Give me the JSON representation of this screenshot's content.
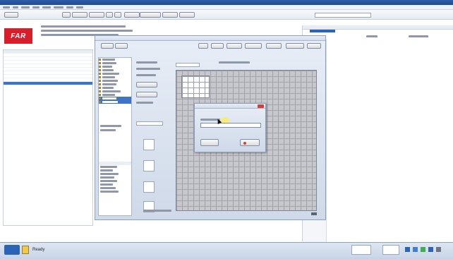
{
  "app": {
    "logo_text": "FAR",
    "title": "",
    "accent_color": "#2b63b6",
    "logo_color": "#d81e2a"
  },
  "dialog": {
    "title": ""
  },
  "modal": {
    "title": "",
    "label": "",
    "value": "",
    "ok_label": "",
    "cancel_label": ""
  },
  "taskbar": {
    "status_label": "Ready"
  },
  "icons": {
    "logo": "app-logo",
    "close": "close-icon",
    "folder": "folder-icon",
    "cursor": "mouse-cursor-icon"
  }
}
